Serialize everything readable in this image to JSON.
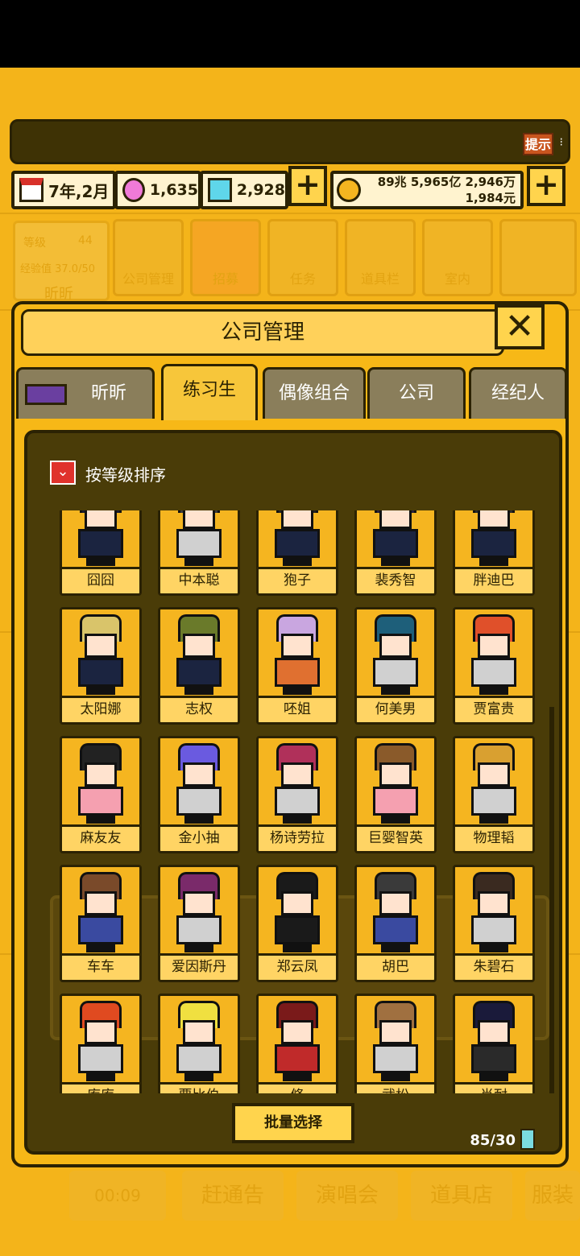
{
  "hint_label": "提示",
  "resources": {
    "date": "7年,2月",
    "pink_gems": "1,635",
    "blue_gems": "2,928",
    "money_line1": "89兆 5,965亿 2,946万",
    "money_line2": "1,984元"
  },
  "bg_menu": {
    "level_label": "等级",
    "level_value": "44",
    "exp_label": "经验值 37.0/50",
    "name": "昕昕",
    "items": [
      "公司管理",
      "招募",
      "任务",
      "道具栏",
      "室内"
    ]
  },
  "modal": {
    "title": "公司管理",
    "tabs": [
      "昕昕",
      "练习生",
      "偶像组合",
      "公司",
      "经纪人"
    ],
    "active_tab": "练习生",
    "sort_label": "按等级排序",
    "batch_label": "批量选择",
    "count": "85/30"
  },
  "trainees": [
    [
      "囧囧",
      "中本聪",
      "狍子",
      "裴秀智",
      "胖迪巴"
    ],
    [
      "太阳娜",
      "志权",
      "呸姐",
      "何美男",
      "贾富贵"
    ],
    [
      "麻友友",
      "金小抽",
      "杨诗劳拉",
      "巨婴智英",
      "物理韬"
    ],
    [
      "车车",
      "爱因斯丹",
      "郑云凤",
      "胡巴",
      "朱碧石"
    ],
    [
      "库库",
      "贾比伯",
      "脩",
      "武松",
      "肖耐"
    ]
  ],
  "bottom_bar": [
    "00:09",
    "赶通告",
    "演唱会",
    "道具店",
    "服装"
  ],
  "colors": {
    "background": "#f4b41a",
    "dark": "#2b2203",
    "inner_panel": "#4a3c08",
    "card": "#fbc42f"
  }
}
